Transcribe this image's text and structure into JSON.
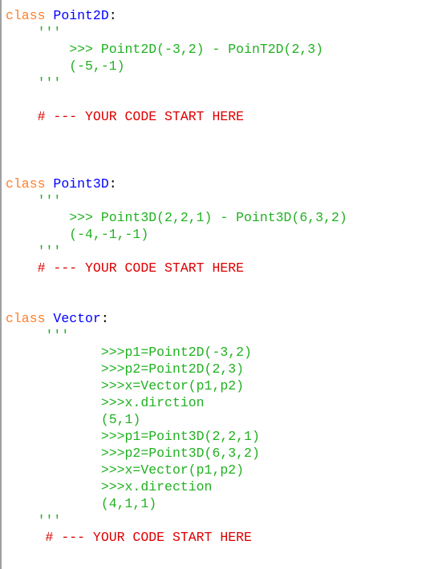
{
  "colors": {
    "keyword": "#ff7f2a",
    "class_name": "#0000ff",
    "docstring": "#21b121",
    "comment": "#dd0000"
  },
  "lines": [
    {
      "indent": "",
      "parts": [
        {
          "t": "kw",
          "v": "class"
        },
        {
          "t": "op",
          "v": " "
        },
        {
          "t": "cls",
          "v": "Point2D"
        },
        {
          "t": "op",
          "v": ":"
        }
      ]
    },
    {
      "indent": "    ",
      "parts": [
        {
          "t": "doc",
          "v": "'''"
        }
      ]
    },
    {
      "indent": "        ",
      "parts": [
        {
          "t": "doc",
          "v": ">>> Point2D(-3,2) - PoinT2D(2,3)"
        }
      ]
    },
    {
      "indent": "        ",
      "parts": [
        {
          "t": "doc",
          "v": "(-5,-1)"
        }
      ]
    },
    {
      "indent": "    ",
      "parts": [
        {
          "t": "doc",
          "v": "'''"
        }
      ]
    },
    {
      "indent": "",
      "parts": []
    },
    {
      "indent": "    ",
      "parts": [
        {
          "t": "cmt",
          "v": "# --- YOUR CODE START HERE"
        }
      ]
    },
    {
      "indent": "",
      "parts": []
    },
    {
      "indent": "",
      "parts": []
    },
    {
      "indent": "",
      "parts": []
    },
    {
      "indent": "",
      "parts": [
        {
          "t": "kw",
          "v": "class"
        },
        {
          "t": "op",
          "v": " "
        },
        {
          "t": "cls",
          "v": "Point3D"
        },
        {
          "t": "op",
          "v": ":"
        }
      ]
    },
    {
      "indent": "    ",
      "parts": [
        {
          "t": "doc",
          "v": "'''"
        }
      ]
    },
    {
      "indent": "        ",
      "parts": [
        {
          "t": "doc",
          "v": ">>> Point3D(2,2,1) - Point3D(6,3,2)"
        }
      ]
    },
    {
      "indent": "        ",
      "parts": [
        {
          "t": "doc",
          "v": "(-4,-1,-1)"
        }
      ]
    },
    {
      "indent": "    ",
      "parts": [
        {
          "t": "doc",
          "v": "'''"
        }
      ]
    },
    {
      "indent": "    ",
      "parts": [
        {
          "t": "cmt",
          "v": "# --- YOUR CODE START HERE"
        }
      ]
    },
    {
      "indent": "",
      "parts": []
    },
    {
      "indent": "",
      "parts": []
    },
    {
      "indent": "",
      "parts": [
        {
          "t": "kw",
          "v": "class"
        },
        {
          "t": "op",
          "v": " "
        },
        {
          "t": "cls",
          "v": "Vector"
        },
        {
          "t": "op",
          "v": ":"
        }
      ]
    },
    {
      "indent": "     ",
      "parts": [
        {
          "t": "doc",
          "v": "'''"
        }
      ]
    },
    {
      "indent": "            ",
      "parts": [
        {
          "t": "doc",
          "v": ">>>p1=Point2D(-3,2)"
        }
      ]
    },
    {
      "indent": "            ",
      "parts": [
        {
          "t": "doc",
          "v": ">>>p2=Point2D(2,3)"
        }
      ]
    },
    {
      "indent": "            ",
      "parts": [
        {
          "t": "doc",
          "v": ">>>x=Vector(p1,p2)"
        }
      ]
    },
    {
      "indent": "            ",
      "parts": [
        {
          "t": "doc",
          "v": ">>>x.dirction"
        }
      ]
    },
    {
      "indent": "            ",
      "parts": [
        {
          "t": "doc",
          "v": "(5,1)"
        }
      ]
    },
    {
      "indent": "            ",
      "parts": [
        {
          "t": "doc",
          "v": ">>>p1=Point3D(2,2,1)"
        }
      ]
    },
    {
      "indent": "            ",
      "parts": [
        {
          "t": "doc",
          "v": ">>>p2=Point3D(6,3,2)"
        }
      ]
    },
    {
      "indent": "            ",
      "parts": [
        {
          "t": "doc",
          "v": ">>>x=Vector(p1,p2)"
        }
      ]
    },
    {
      "indent": "            ",
      "parts": [
        {
          "t": "doc",
          "v": ">>>x.direction"
        }
      ]
    },
    {
      "indent": "            ",
      "parts": [
        {
          "t": "doc",
          "v": "(4,1,1)"
        }
      ]
    },
    {
      "indent": "    ",
      "parts": [
        {
          "t": "doc",
          "v": "'''"
        }
      ]
    },
    {
      "indent": "     ",
      "parts": [
        {
          "t": "cmt",
          "v": "# --- YOUR CODE START HERE"
        }
      ]
    }
  ]
}
